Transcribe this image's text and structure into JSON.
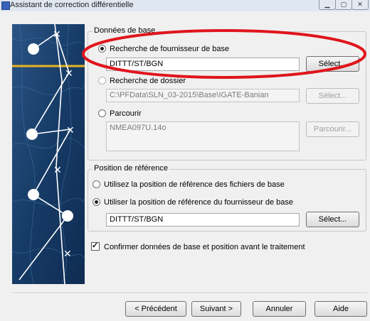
{
  "window": {
    "title": "Assistant de correction différentielle",
    "minimize_icon": "minimize-icon",
    "maximize_icon": "maximize-icon",
    "close_icon": "close-icon"
  },
  "base_data": {
    "legend": "Données de base",
    "provider_search": {
      "label": "Recherche de fournisseur de base",
      "selected": true,
      "value": "DITTT/ST/BGN",
      "button": "Sélect..."
    },
    "folder_search": {
      "label": "Recherche de dossier",
      "selected": false,
      "value": "C:\\PFData\\SLN_03-2015\\Base\\IGATE-Banian",
      "button": "Sélect..."
    },
    "browse": {
      "label": "Parcourir",
      "selected": false,
      "value": "NMEA097U.14o",
      "button": "Parcourir..."
    }
  },
  "reference_position": {
    "legend": "Position de référence",
    "use_files": {
      "label": "Utilisez la position de référence des fichiers de base",
      "selected": false
    },
    "use_provider": {
      "label": "Utiliser la position de référence du fournisseur de base",
      "selected": true,
      "value": "DITTT/ST/BGN",
      "button": "Sélect..."
    }
  },
  "confirm": {
    "label": "Confirmer données de base et position avant le traitement",
    "checked": true
  },
  "footer": {
    "previous": "< Précédent",
    "next": "Suivant >",
    "cancel": "Annuler",
    "help": "Aide"
  },
  "colors": {
    "annotation_red": "#e0151d",
    "banner_blue": "#193e6a",
    "banner_gold": "#e6b422"
  }
}
